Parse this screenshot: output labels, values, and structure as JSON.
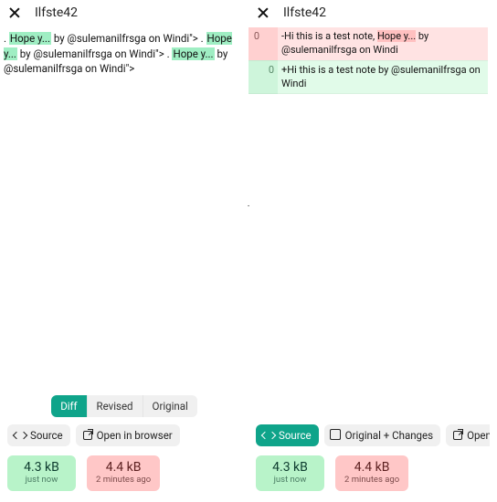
{
  "left": {
    "title": "Ilfste42",
    "body": {
      "t1": ". ",
      "h1": "Hope y...",
      "t2": " by @sulemanilfrsga on Windi\"> . ",
      "h2": "Hope y...",
      "t3": " by @sulemanilfrsga on Windi\"> . ",
      "h3": "Hope y...",
      "t4": " by @sulemanilfrsga on Windi\">"
    },
    "segments": {
      "diff": "Diff",
      "revised": "Revised",
      "original": "Original"
    },
    "buttons": {
      "source": "Source",
      "open": "Open in browser"
    },
    "sizes": {
      "revised": {
        "size": "4.3 kB",
        "age": "just now"
      },
      "original": {
        "size": "4.4 kB",
        "age": "2 minutes ago"
      }
    }
  },
  "right": {
    "title": "Ilfste42",
    "diff": {
      "row1": {
        "ln1": "0",
        "ln2": "",
        "pre": "-Hi this is a test note, ",
        "hl": "Hope y...",
        "post": " by @sulemanilfrsga on Windi"
      },
      "row2": {
        "ln1": "",
        "ln2": "0",
        "text": "+Hi this is a test note by @sulemanilfrsga on Windi"
      }
    },
    "buttons": {
      "source": "Source",
      "orig_changes": "Original + Changes",
      "open": "Open in brow"
    },
    "sizes": {
      "revised": {
        "size": "4.3 kB",
        "age": "just now"
      },
      "original": {
        "size": "4.4 kB",
        "age": "2 minutes ago"
      }
    }
  }
}
